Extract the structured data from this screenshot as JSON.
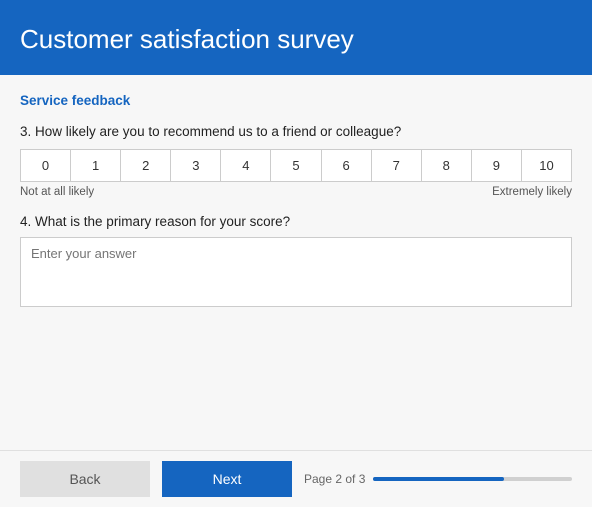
{
  "header": {
    "title": "Customer satisfaction survey"
  },
  "section": {
    "label": "Service feedback"
  },
  "question3": {
    "number": "3.",
    "text": "How likely are you to recommend us to a friend or colleague?",
    "scale": [
      0,
      1,
      2,
      3,
      4,
      5,
      6,
      7,
      8,
      9,
      10
    ],
    "label_left": "Not at all likely",
    "label_right": "Extremely likely"
  },
  "question4": {
    "number": "4.",
    "text": "What is the primary reason for your score?",
    "placeholder": "Enter your answer"
  },
  "footer": {
    "back_label": "Back",
    "next_label": "Next",
    "page_text": "Page 2 of 3",
    "progress_pct": 66
  }
}
